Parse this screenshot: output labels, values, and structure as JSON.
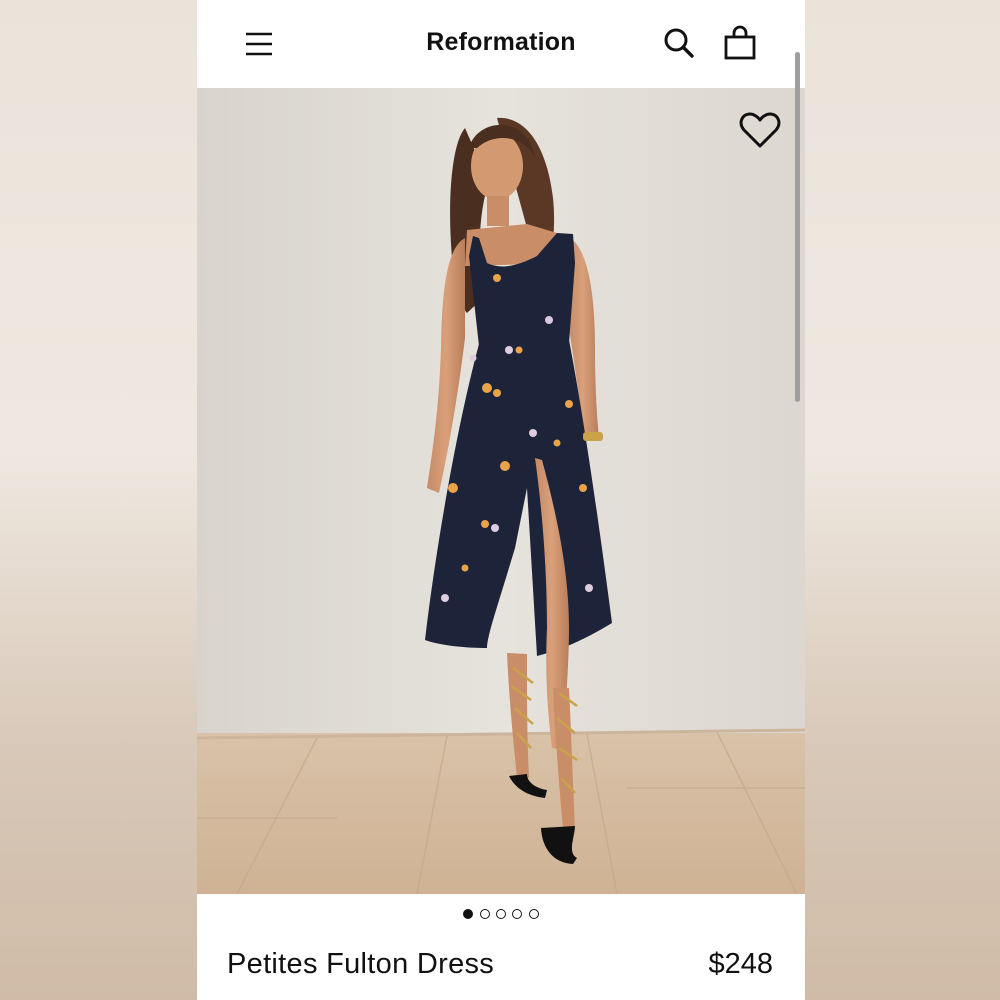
{
  "header": {
    "brand": "Reformation",
    "menu_icon": "hamburger-menu-icon",
    "search_icon": "search-icon",
    "bag_icon": "shopping-bag-icon"
  },
  "hero": {
    "favorite_icon": "heart-outline-icon",
    "image_subject": "model wearing navy floral midi dress with side slit and gold lace-up sandals"
  },
  "carousel": {
    "total_slides": 5,
    "active_index": 0
  },
  "product": {
    "name": "Petites Fulton Dress",
    "price": "$248"
  },
  "colors": {
    "text": "#111111",
    "dress_navy": "#1d2338",
    "wall": "#e2ddd6",
    "floor": "#d9bfa3"
  }
}
